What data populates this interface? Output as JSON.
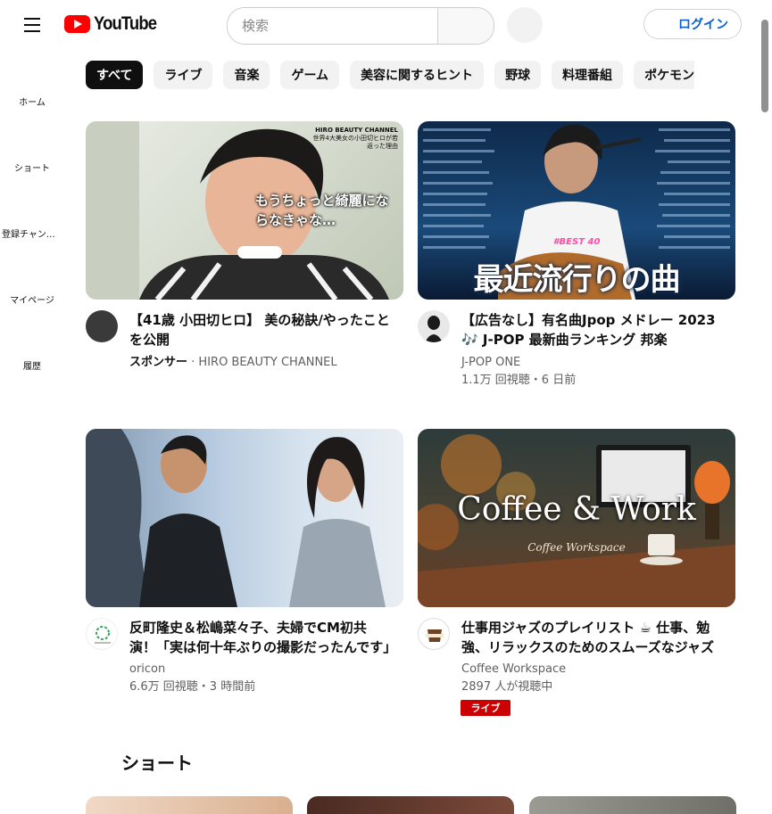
{
  "header": {
    "logo_text": "YouTube",
    "search_placeholder": "検索",
    "login_label": "ログイン"
  },
  "sidebar": {
    "items": [
      {
        "label": "ホーム"
      },
      {
        "label": "ショート"
      },
      {
        "label": "登録チャンネル"
      },
      {
        "label": "マイページ"
      },
      {
        "label": "履歴"
      }
    ]
  },
  "chips": [
    "すべて",
    "ライブ",
    "音楽",
    "ゲーム",
    "美容に関するヒント",
    "野球",
    "料理番組",
    "ポケモン"
  ],
  "videos": [
    {
      "title": "【41歳 小田切ヒロ】 美の秘訣/やったことを公開",
      "sponsor_label": "スポンサー",
      "channel": "HIRO BEAUTY CHANNEL",
      "thumb_channel_tag": "HIRO BEAUTY CHANNEL",
      "thumb_subtitle": "世界4大美女の小田切ヒロが若返った理由",
      "thumb_caption": "もうちょっと綺麗にならなきゃな…"
    },
    {
      "title": "【広告なし】有名曲Jpop メドレー 2023 🎶 J-POP 最新曲ランキング 邦楽",
      "channel": "J-POP ONE",
      "stats": "1.1万 回視聴・6 日前",
      "thumb_caption": "最近流行りの曲",
      "thumb_tag": "#BEST 40"
    },
    {
      "title": "反町隆史＆松嶋菜々子、夫婦でCM初共演！「実は何十年ぶりの撮影だったんです」",
      "channel": "oricon",
      "stats": "6.6万 回視聴・3 時間前"
    },
    {
      "title": "仕事用ジャズのプレイリスト ☕ 仕事、勉強、リラックスのためのスムーズなジャズ",
      "channel": "Coffee Workspace",
      "stats": "2897 人が視聴中",
      "live_label": "ライブ",
      "thumb_caption": "Coffee & Work",
      "thumb_script": "Coffee Workspace"
    }
  ],
  "shorts": {
    "heading": "ショート"
  },
  "colors": {
    "brand_red": "#ff0000",
    "live_red": "#cc0000",
    "link_blue": "#065fd4"
  }
}
